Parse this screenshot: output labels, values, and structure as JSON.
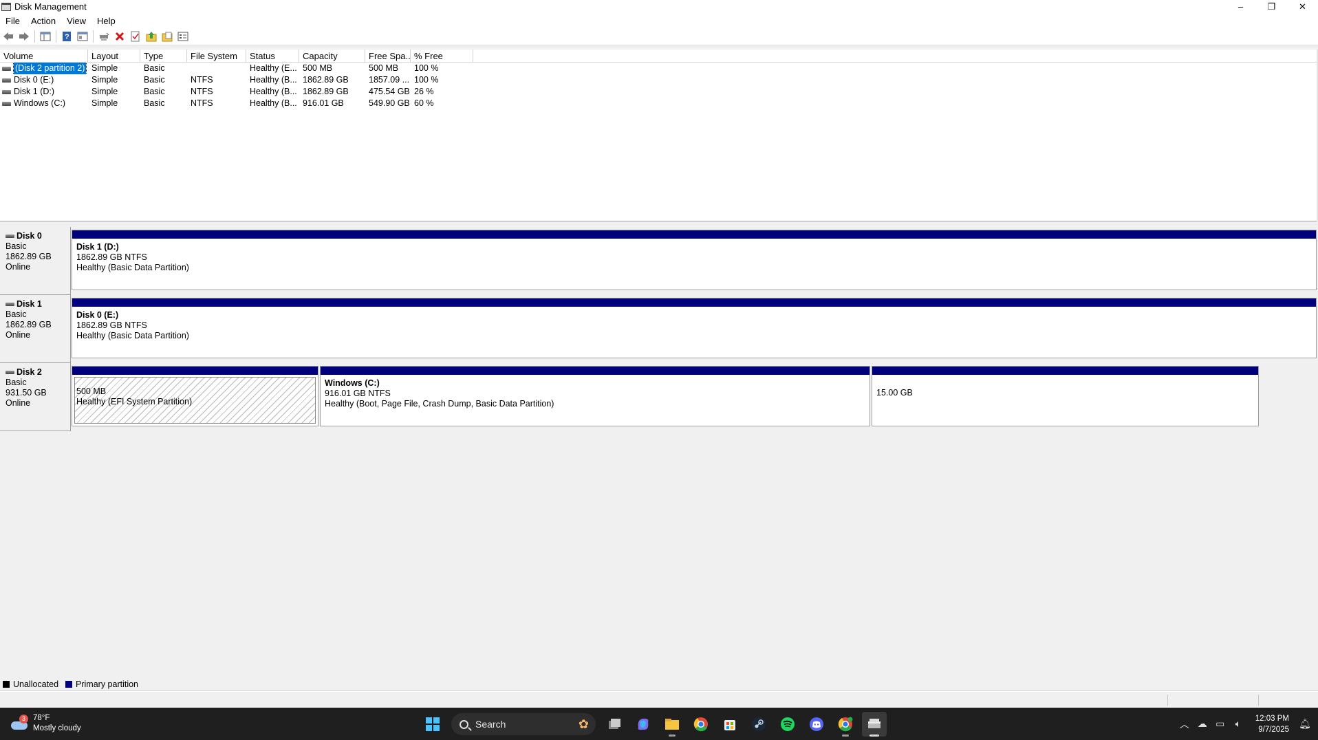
{
  "window": {
    "title": "Disk Management",
    "controls": {
      "minimize": "–",
      "restore": "❐",
      "close": "✕"
    }
  },
  "menu": [
    "File",
    "Action",
    "View",
    "Help"
  ],
  "toolbar": {
    "icons": [
      "back-icon",
      "forward-icon",
      "show-hide-console-tree-icon",
      "help-icon",
      "properties-icon",
      "connect-icon",
      "delete-icon",
      "check-icon",
      "up-folder-icon",
      "open-icon",
      "view-icon"
    ]
  },
  "volume_list": {
    "columns": [
      "Volume",
      "Layout",
      "Type",
      "File System",
      "Status",
      "Capacity",
      "Free Spa...",
      "% Free"
    ],
    "rows": [
      {
        "volume": "(Disk 2 partition 2)",
        "layout": "Simple",
        "type": "Basic",
        "fs": "",
        "status": "Healthy (E...",
        "capacity": "500 MB",
        "free": "500 MB",
        "pct": "100 %",
        "selected": true
      },
      {
        "volume": "Disk 0 (E:)",
        "layout": "Simple",
        "type": "Basic",
        "fs": "NTFS",
        "status": "Healthy (B...",
        "capacity": "1862.89 GB",
        "free": "1857.09 ...",
        "pct": "100 %",
        "selected": false
      },
      {
        "volume": "Disk 1 (D:)",
        "layout": "Simple",
        "type": "Basic",
        "fs": "NTFS",
        "status": "Healthy (B...",
        "capacity": "1862.89 GB",
        "free": "475.54 GB",
        "pct": "26 %",
        "selected": false
      },
      {
        "volume": "Windows (C:)",
        "layout": "Simple",
        "type": "Basic",
        "fs": "NTFS",
        "status": "Healthy (B...",
        "capacity": "916.01 GB",
        "free": "549.90 GB",
        "pct": "60 %",
        "selected": false
      }
    ]
  },
  "disks": [
    {
      "name": "Disk 0",
      "type": "Basic",
      "size": "1862.89 GB",
      "state": "Online",
      "partitions": [
        {
          "label": "Disk 1  (D:)",
          "size_fs": "1862.89 GB NTFS",
          "status": "Healthy (Basic Data Partition)"
        }
      ]
    },
    {
      "name": "Disk 1",
      "type": "Basic",
      "size": "1862.89 GB",
      "state": "Online",
      "partitions": [
        {
          "label": "Disk 0  (E:)",
          "size_fs": "1862.89 GB NTFS",
          "status": "Healthy (Basic Data Partition)"
        }
      ]
    },
    {
      "name": "Disk 2",
      "type": "Basic",
      "size": "931.50 GB",
      "state": "Online",
      "partitions": [
        {
          "label": "",
          "size_fs": "500 MB",
          "status": "Healthy (EFI System Partition)"
        },
        {
          "label": "Windows  (C:)",
          "size_fs": "916.01 GB NTFS",
          "status": "Healthy (Boot, Page File, Crash Dump, Basic Data Partition)"
        },
        {
          "label": "",
          "size_fs": "15.00 GB",
          "status": ""
        }
      ]
    }
  ],
  "legend": [
    {
      "label": "Unallocated",
      "color": "#000000"
    },
    {
      "label": "Primary partition",
      "color": "#00007f"
    }
  ],
  "taskbar": {
    "weather": {
      "temp": "78°F",
      "desc": "Mostly cloudy",
      "badge": "3"
    },
    "search_label": "Search",
    "apps": [
      "start-icon",
      "task-view-icon",
      "copilot-icon",
      "file-explorer-icon",
      "chrome-icon",
      "microsoft-store-icon",
      "steam-icon",
      "spotify-icon",
      "discord-icon",
      "chrome-profile-icon",
      "disk-management-icon"
    ],
    "clock": {
      "time": "12:03 PM",
      "date": "9/7/2025"
    }
  },
  "colors": {
    "partition_bar": "#00007f",
    "selection": "#0078d7",
    "taskbar": "#1f1f1f"
  }
}
